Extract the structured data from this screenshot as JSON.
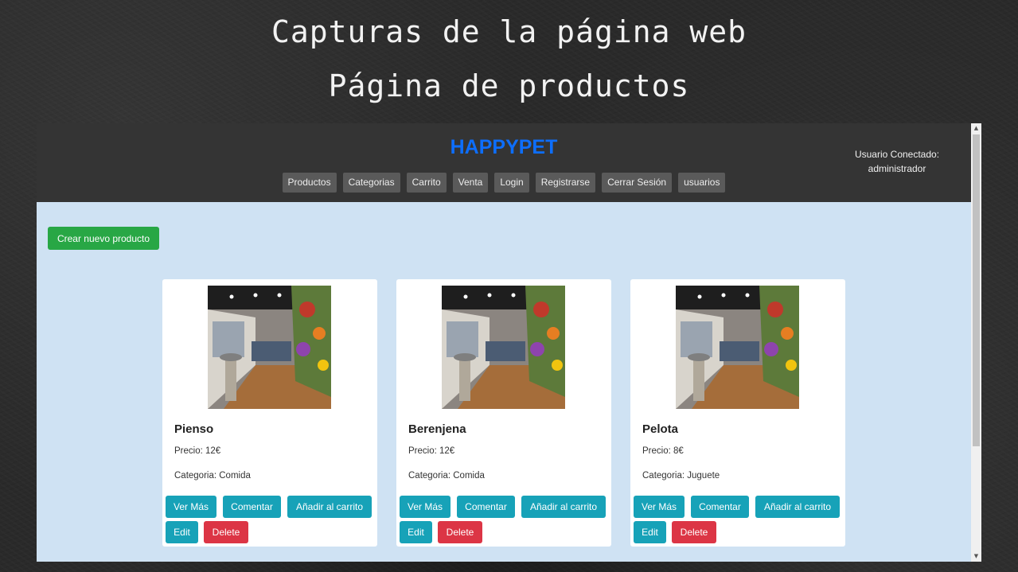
{
  "slide": {
    "title": "Capturas de la página web",
    "subtitle": "Página de productos"
  },
  "site": {
    "brand": "HAPPYPET",
    "brand_color": "#0d6efd",
    "nav": [
      {
        "label": "Productos"
      },
      {
        "label": "Categorias"
      },
      {
        "label": "Carrito"
      },
      {
        "label": "Venta"
      },
      {
        "label": "Login"
      },
      {
        "label": "Registrarse"
      },
      {
        "label": "Cerrar Sesión"
      },
      {
        "label": "usuarios"
      }
    ],
    "user": {
      "label": "Usuario Conectado:",
      "name": "administrador"
    },
    "create_button": "Crear nuevo producto",
    "products": [
      {
        "name": "Pienso",
        "price": "Precio: 12€",
        "category": "Categoria: Comida"
      },
      {
        "name": "Berenjena",
        "price": "Precio: 12€",
        "category": "Categoria: Comida"
      },
      {
        "name": "Pelota",
        "price": "Precio: 8€",
        "category": "Categoria: Juguete"
      }
    ],
    "card_buttons": {
      "view": "Ver Más",
      "comment": "Comentar",
      "add_cart": "Añadir al carrito",
      "edit": "Edit",
      "delete": "Delete"
    },
    "colors": {
      "navbar": "#343434",
      "page_background": "#cfe2f3",
      "success": "#28a745",
      "info": "#17a2b8",
      "danger": "#dc3545"
    }
  }
}
